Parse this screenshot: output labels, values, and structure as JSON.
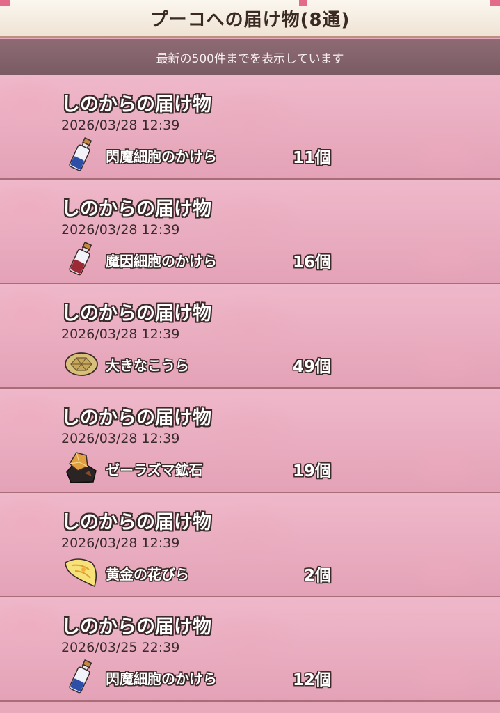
{
  "header": {
    "title": "プーコへの届け物(8通)",
    "subtitle": "最新の500件までを表示しています"
  },
  "deliveries": [
    {
      "sender": "しのからの届け物",
      "date": "2026/03/28  12:39",
      "item": "閃魔細胞のかけら",
      "qty": "11個",
      "icon": "vial-icon"
    },
    {
      "sender": "しのからの届け物",
      "date": "2026/03/28  12:39",
      "item": "魔因細胞のかけら",
      "qty": "16個",
      "icon": "vial-red-icon"
    },
    {
      "sender": "しのからの届け物",
      "date": "2026/03/28  12:39",
      "item": "大きなこうら",
      "qty": "49個",
      "icon": "shell-icon"
    },
    {
      "sender": "しのからの届け物",
      "date": "2026/03/28  12:39",
      "item": "ゼーラズマ鉱石",
      "qty": "19個",
      "icon": "ore-icon"
    },
    {
      "sender": "しのからの届け物",
      "date": "2026/03/28  12:39",
      "item": "黄金の花びら",
      "qty": "2個",
      "icon": "petal-icon"
    },
    {
      "sender": "しのからの届け物",
      "date": "2026/03/25  22:39",
      "item": "閃魔細胞のかけら",
      "qty": "12個",
      "icon": "vial-icon"
    }
  ],
  "colors": {
    "row_bg": "#e9a9be",
    "subbar_bg": "#84636b",
    "title_text": "#3b2a22"
  }
}
